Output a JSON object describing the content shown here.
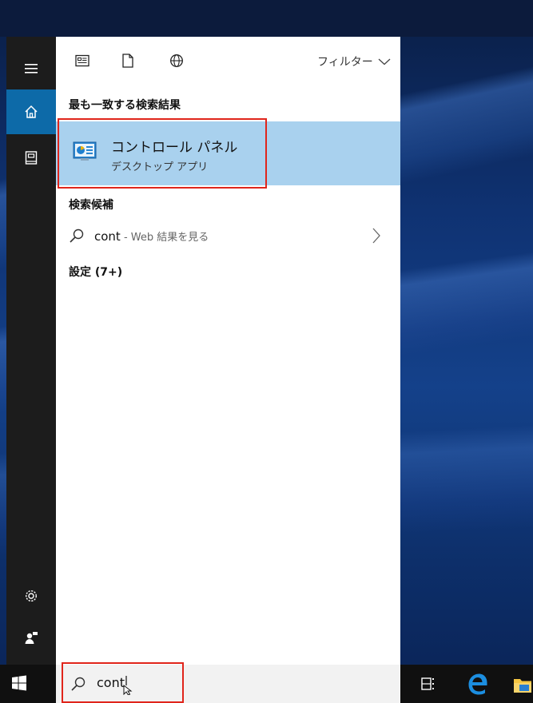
{
  "start_menu": {
    "toolbar": {
      "filter_label": "フィルター"
    },
    "best_match": {
      "header": "最も一致する検索結果",
      "title": "コントロール パネル",
      "subtitle": "デスクトップ アプリ"
    },
    "suggestions": {
      "header": "検索候補",
      "items": [
        {
          "query": "cont",
          "hint": " - Web 結果を見る"
        }
      ]
    },
    "settings": {
      "header": "設定 (7+)"
    }
  },
  "taskbar": {
    "search": {
      "value": "cont"
    }
  },
  "colors": {
    "highlight": "#a9d1ee",
    "rail_active": "#0d6aa8",
    "annotation_box": "#e0251b"
  }
}
